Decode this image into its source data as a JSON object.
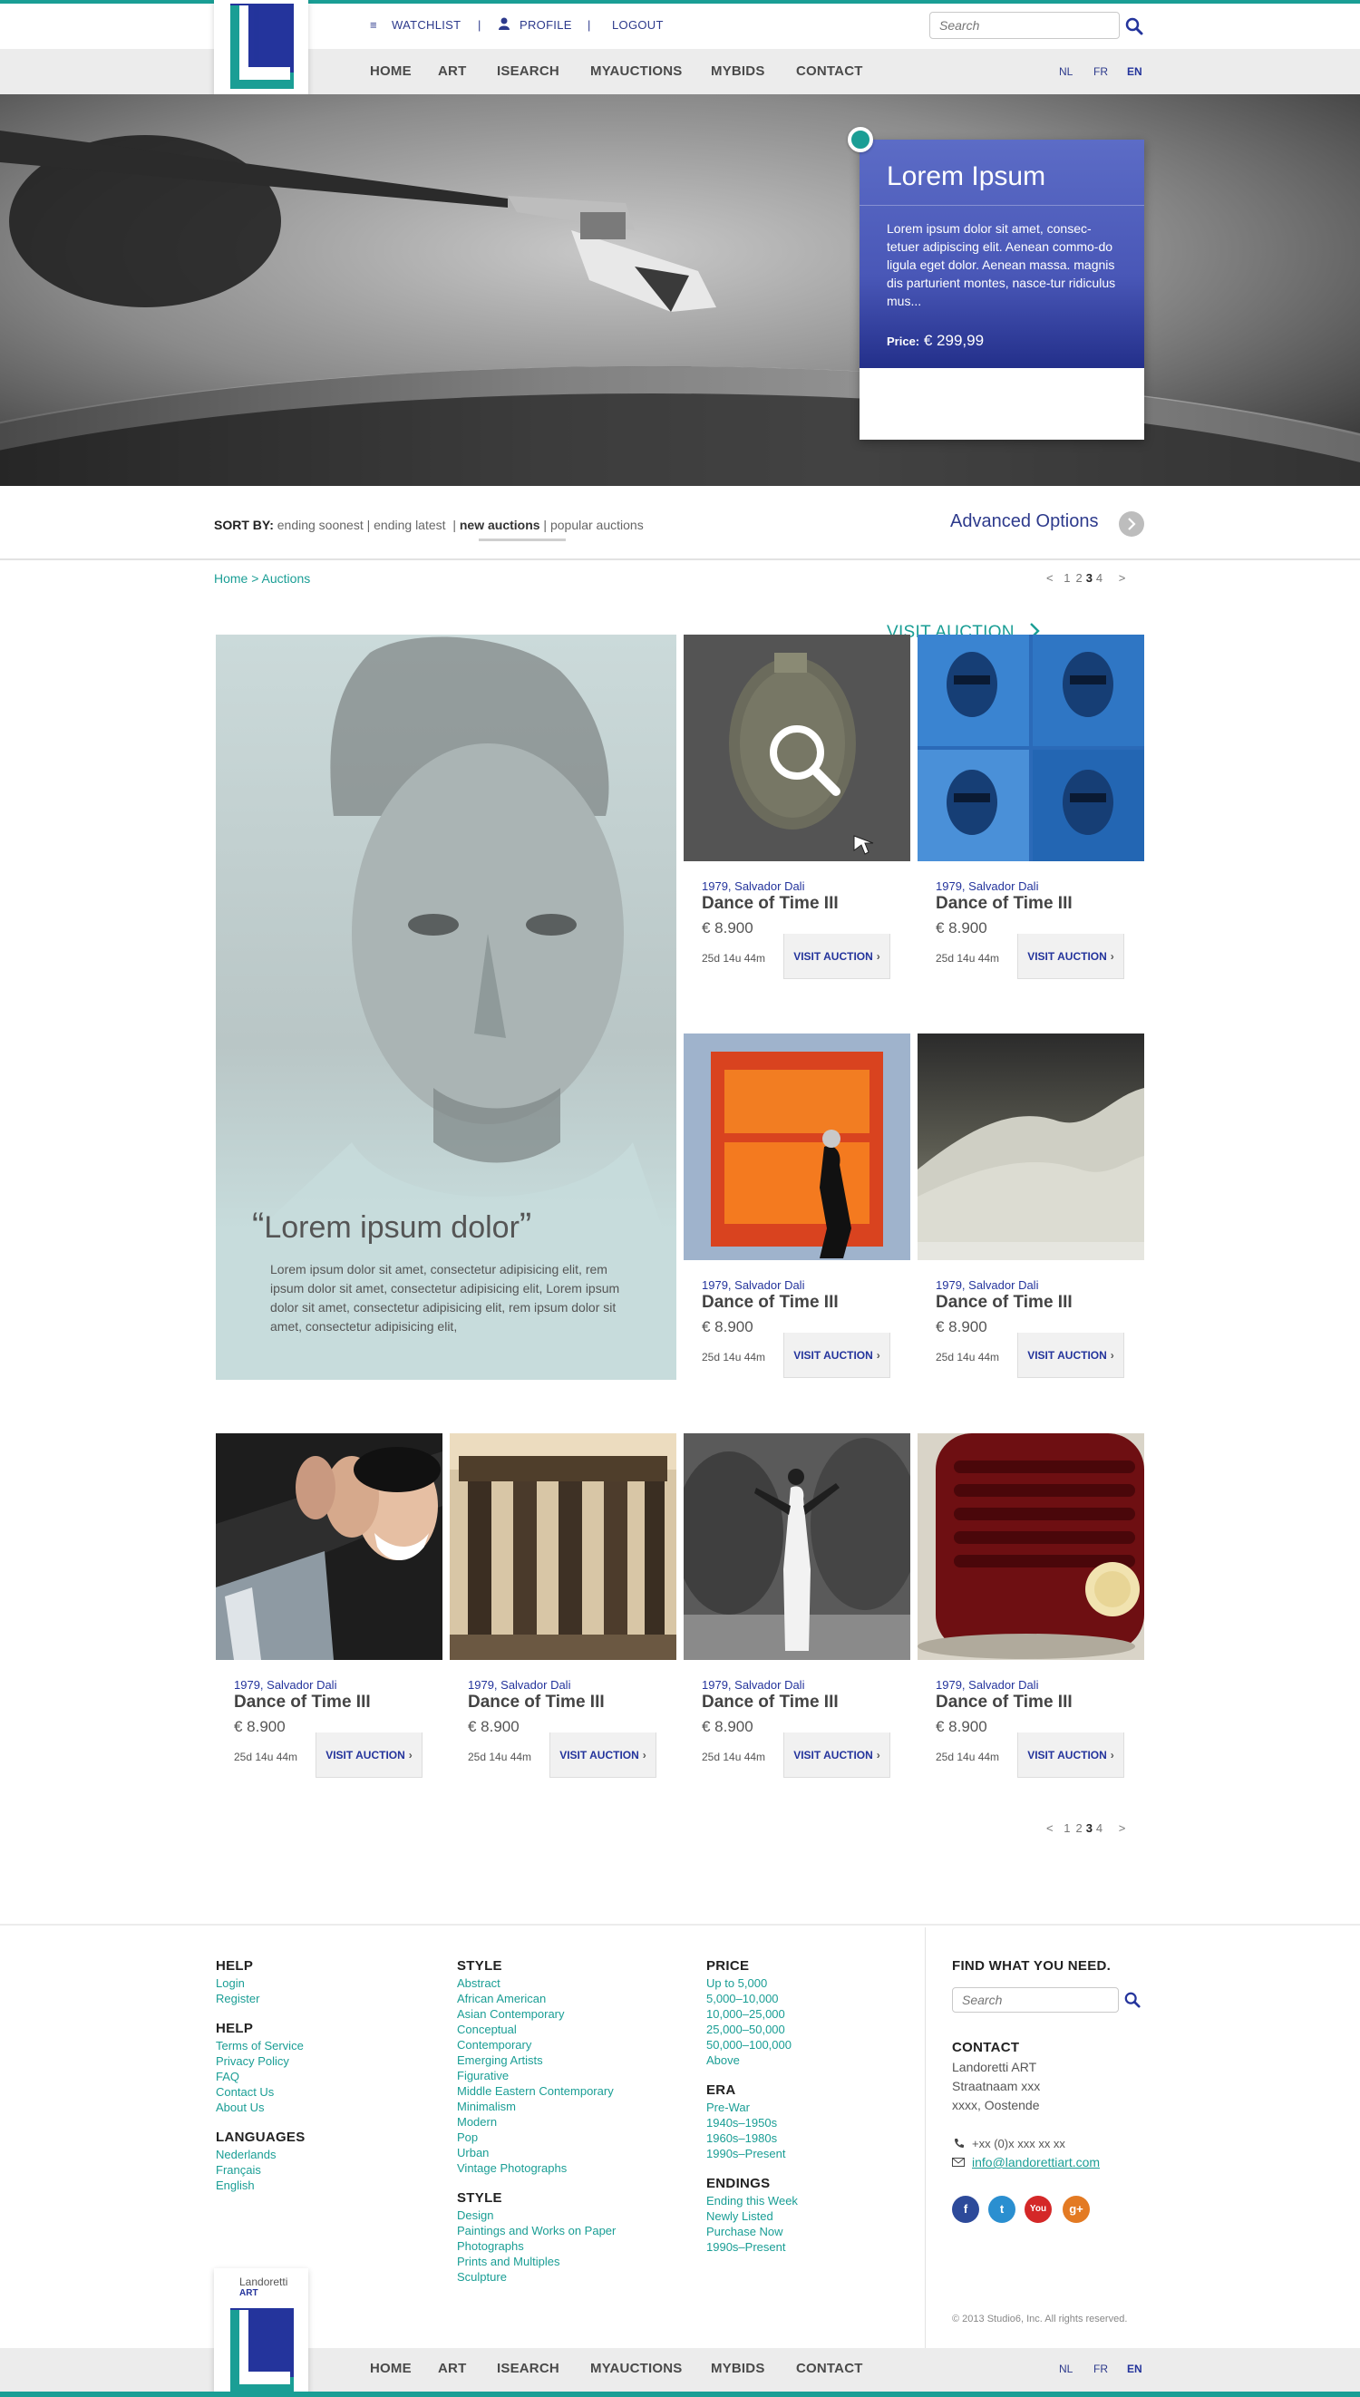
{
  "brand": {
    "name": "Landoretti",
    "sub": "ART",
    "accent": "#1a9e95",
    "primary": "#24349c"
  },
  "user_menu": {
    "watchlist": "WATCHLIST",
    "profile": "PROFILE",
    "logout": "LOGOUT",
    "separator": "|"
  },
  "search": {
    "placeholder": "Search"
  },
  "nav": [
    "HOME",
    "ART",
    "ISEARCH",
    "MYAUCTIONS",
    "MYBIDS",
    "CONTACT"
  ],
  "languages": [
    {
      "code": "NL",
      "active": false
    },
    {
      "code": "FR",
      "active": false
    },
    {
      "code": "EN",
      "active": true
    }
  ],
  "hero": {
    "title": "Lorem Ipsum",
    "description": "Lorem ipsum dolor sit amet, consec-tetuer adipiscing elit. Aenean commo-do ligula eget dolor. Aenean massa. magnis dis parturient montes, nasce-tur ridiculus mus...",
    "price_label": "Price:",
    "price_value": "€ 299,99",
    "cta": "VISIT AUCTION",
    "cta_icon": "chevron-right-icon"
  },
  "sort": {
    "label": "SORT BY:",
    "options": [
      "ending soonest",
      "ending latest",
      "new auctions",
      "popular auctions"
    ],
    "active": "new auctions",
    "advanced": "Advanced Options"
  },
  "breadcrumb": "Home > Auctions",
  "pagination": {
    "prev": "<",
    "next": ">",
    "pages": [
      "1",
      "2",
      "3",
      "4"
    ],
    "current": "3"
  },
  "featured": {
    "quote": "Lorem ipsum dolor",
    "text": "Lorem ipsum dolor sit amet, consectetur adipisicing elit, rem ipsum dolor sit amet, consectetur adipisicing elit, Lorem ipsum dolor sit amet, consectetur adipisicing elit, rem ipsum dolor sit amet, consectetur adipisicing elit,"
  },
  "products": [
    {
      "meta": "1979, Salvador Dali",
      "title": "Dance of Time III",
      "price": "€ 8.900",
      "time": "25d 14u 44m",
      "cta": "VISIT AUCTION"
    },
    {
      "meta": "1979, Salvador Dali",
      "title": "Dance of Time III",
      "price": "€ 8.900",
      "time": "25d 14u 44m",
      "cta": "VISIT AUCTION"
    },
    {
      "meta": "1979, Salvador Dali",
      "title": "Dance of Time III",
      "price": "€ 8.900",
      "time": "25d 14u 44m",
      "cta": "VISIT AUCTION"
    },
    {
      "meta": "1979, Salvador Dali",
      "title": "Dance of Time III",
      "price": "€ 8.900",
      "time": "25d 14u 44m",
      "cta": "VISIT AUCTION"
    },
    {
      "meta": "1979, Salvador Dali",
      "title": "Dance of Time III",
      "price": "€ 8.900",
      "time": "25d 14u 44m",
      "cta": "VISIT AUCTION"
    },
    {
      "meta": "1979, Salvador Dali",
      "title": "Dance of Time III",
      "price": "€ 8.900",
      "time": "25d 14u 44m",
      "cta": "VISIT AUCTION"
    },
    {
      "meta": "1979, Salvador Dali",
      "title": "Dance of Time III",
      "price": "€ 8.900",
      "time": "25d 14u 44m",
      "cta": "VISIT AUCTION"
    },
    {
      "meta": "1979, Salvador Dali",
      "title": "Dance of Time III",
      "price": "€ 8.900",
      "time": "25d 14u 44m",
      "cta": "VISIT AUCTION"
    }
  ],
  "footer": {
    "col1": [
      {
        "heading": "HELP",
        "links": [
          "Login",
          "Register"
        ]
      },
      {
        "heading": "HELP",
        "links": [
          "Terms of Service",
          "Privacy Policy",
          "FAQ",
          "Contact Us",
          "About Us"
        ]
      },
      {
        "heading": "LANGUAGES",
        "links": [
          "Nederlands",
          "Français",
          "English"
        ]
      }
    ],
    "col2": [
      {
        "heading": "STYLE",
        "links": [
          "Abstract",
          "African American",
          "Asian Contemporary",
          "Conceptual",
          "Contemporary",
          "Emerging Artists",
          "Figurative",
          "Middle Eastern Contemporary",
          "Minimalism",
          "Modern",
          "Pop",
          "Urban",
          "Vintage Photographs"
        ]
      },
      {
        "heading": "STYLE",
        "links": [
          "Design",
          "Paintings and Works on Paper",
          "Photographs",
          "Prints and Multiples",
          "Sculpture"
        ]
      }
    ],
    "col3": [
      {
        "heading": "PRICE",
        "links": [
          "Up to 5,000",
          "5,000–10,000",
          "10,000–25,000",
          "25,000–50,000",
          "50,000–100,000",
          "Above"
        ]
      },
      {
        "heading": "ERA",
        "links": [
          "Pre-War",
          "1940s–1950s",
          "1960s–1980s",
          "1990s–Present"
        ]
      },
      {
        "heading": "ENDINGS",
        "links": [
          "Ending this Week",
          "Newly Listed",
          "Purchase Now",
          "1990s–Present"
        ]
      }
    ],
    "find_heading": "FIND WHAT YOU NEED.",
    "contact_heading": "CONTACT",
    "contact_lines": [
      "Landoretti ART",
      "Straatnaam xxx",
      "xxxx, Oostende"
    ],
    "phone": "+xx (0)x xxx xx xx",
    "email": "info@landorettiart.com",
    "social": [
      {
        "name": "facebook-icon",
        "glyph": "f",
        "color": "#2d4a9a"
      },
      {
        "name": "twitter-icon",
        "glyph": "t",
        "color": "#2a8fd0"
      },
      {
        "name": "youtube-icon",
        "glyph": "You",
        "color": "#d42828"
      },
      {
        "name": "googleplus-icon",
        "glyph": "g+",
        "color": "#e37a23"
      }
    ],
    "copyright": "© 2013 Studio6, Inc. All rights reserved."
  }
}
